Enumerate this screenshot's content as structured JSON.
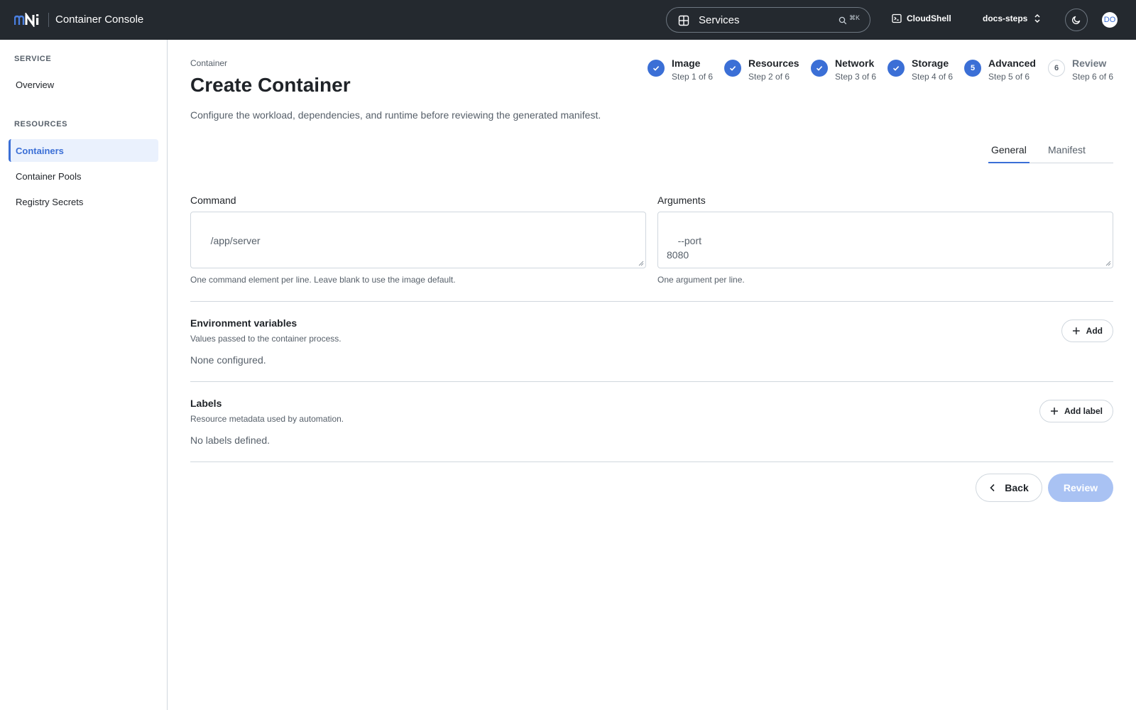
{
  "topbar": {
    "logo_text": "mNi",
    "app_title": "Container Console",
    "search_text": "Services",
    "search_shortcut": "⌘K",
    "cloudshell_label": "CloudShell",
    "project_label": "docs-steps",
    "avatar_initials": "DO",
    "icons": [
      "grid-icon",
      "search-icon",
      "terminal-icon",
      "chevron-updown-icon",
      "moon-icon"
    ]
  },
  "sidebar": {
    "service_heading": "SERVICE",
    "overview_label": "Overview",
    "resources_heading": "RESOURCES",
    "items": [
      {
        "label": "Containers",
        "active": true
      },
      {
        "label": "Container Pools",
        "active": false
      },
      {
        "label": "Registry Secrets",
        "active": false
      }
    ]
  },
  "page": {
    "breadcrumb": "Container",
    "title": "Create Container",
    "description": "Configure the workload, dependencies, and runtime before reviewing the generated manifest."
  },
  "stepper": {
    "steps": [
      {
        "label": "Image",
        "sub": "Step 1 of 6",
        "state": "done",
        "number": "1"
      },
      {
        "label": "Resources",
        "sub": "Step 2 of 6",
        "state": "done",
        "number": "2"
      },
      {
        "label": "Network",
        "sub": "Step 3 of 6",
        "state": "done",
        "number": "3"
      },
      {
        "label": "Storage",
        "sub": "Step 4 of 6",
        "state": "done",
        "number": "4"
      },
      {
        "label": "Advanced",
        "sub": "Step 5 of 6",
        "state": "current",
        "number": "5"
      },
      {
        "label": "Review",
        "sub": "Step 6 of 6",
        "state": "todo",
        "number": "6"
      }
    ]
  },
  "tabs": {
    "general": "General",
    "manifest": "Manifest",
    "active": "General"
  },
  "command": {
    "label": "Command",
    "value": "/app/server",
    "hint": "One command element per line. Leave blank to use the image default."
  },
  "arguments": {
    "label": "Arguments",
    "value": "--port\n8080",
    "hint": "One argument per line."
  },
  "env": {
    "title": "Environment variables",
    "subtitle": "Values passed to the container process.",
    "empty": "None configured.",
    "add_label": "Add"
  },
  "labels": {
    "title": "Labels",
    "subtitle": "Resource metadata used by automation.",
    "empty": "No labels defined.",
    "add_label": "Add label"
  },
  "footer": {
    "back_label": "Back",
    "review_label": "Review"
  },
  "colors": {
    "topbar_bg": "#24292f",
    "accent": "#3b6fd6",
    "accent_disabled": "#a9c2f3",
    "border": "#d0d7de",
    "muted_text": "#57606a"
  }
}
